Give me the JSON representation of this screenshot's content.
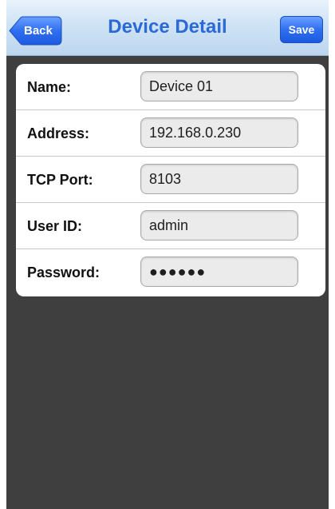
{
  "navbar": {
    "title": "Device Detail",
    "back_label": "Back",
    "save_label": "Save"
  },
  "form": {
    "rows": [
      {
        "label": "Name:",
        "value": "Device 01"
      },
      {
        "label": "Address:",
        "value": "192.168.0.230"
      },
      {
        "label": "TCP Port:",
        "value": "8103"
      },
      {
        "label": "User ID:",
        "value": "admin"
      },
      {
        "label": "Password:",
        "value": "●●●●●●"
      }
    ]
  },
  "colors": {
    "navbar_bg": "#cfe3f5",
    "title_color": "#2b68d8",
    "button_blue": "#2f6ff0",
    "screen_bg": "#3f3f3f"
  }
}
